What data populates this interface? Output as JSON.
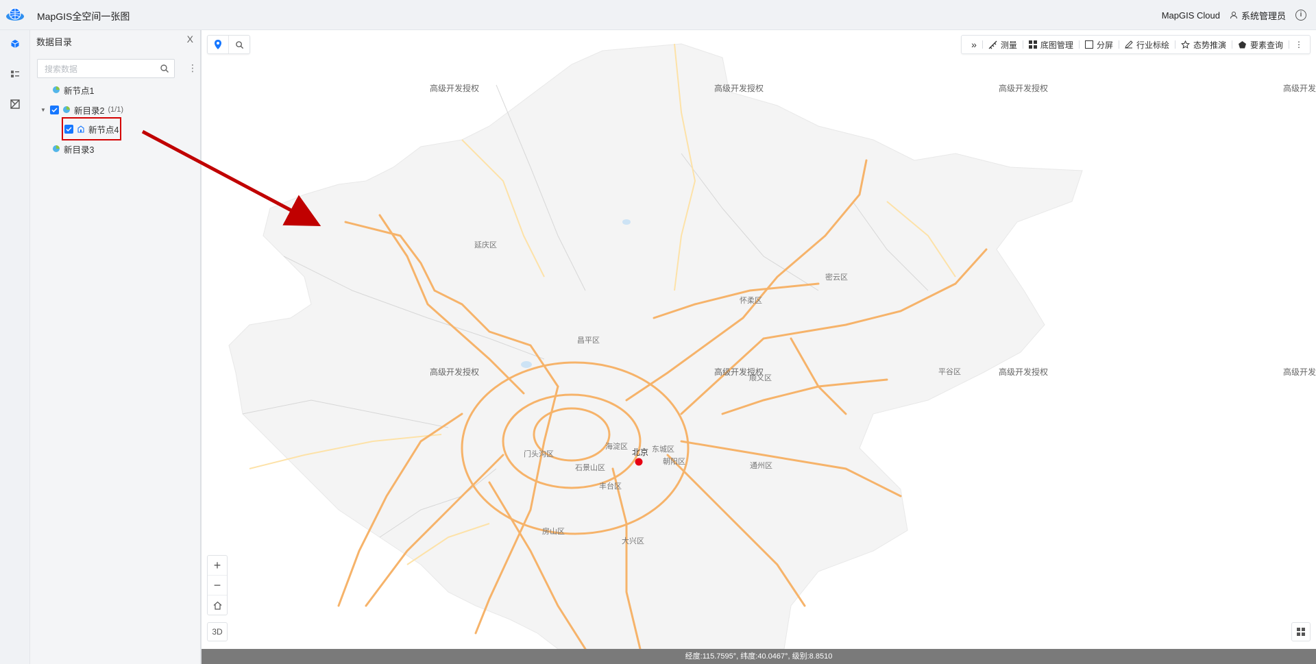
{
  "app": {
    "title": "MapGIS全空间一张图"
  },
  "header": {
    "cloud": "MapGIS Cloud",
    "user": "系统管理员",
    "info_glyph": "i"
  },
  "rail": {
    "items": [
      "cube-icon",
      "layer-list-icon",
      "analysis-icon"
    ]
  },
  "panel": {
    "title": "数据目录",
    "close": "X",
    "search_placeholder": "搜索数据",
    "more_glyph": "⋮",
    "tree": [
      {
        "label": "新节点1",
        "checked": null
      },
      {
        "label": "新目录2",
        "count": "(1/1)",
        "checked": true,
        "expanded": true
      },
      {
        "label": "新节点4",
        "checked": true,
        "highlighted": true
      },
      {
        "label": "新目录3",
        "checked": null
      }
    ]
  },
  "toolbar": {
    "collapse_glyph": "»",
    "items": [
      "测量",
      "底图管理",
      "分屏",
      "行业标绘",
      "态势推演",
      "要素查询"
    ],
    "more_glyph": "⋮"
  },
  "map": {
    "watermark": "高级开发授权",
    "capital": "北京",
    "districts": [
      "延庆区",
      "怀柔区",
      "密云区",
      "昌平区",
      "顺义区",
      "平谷区",
      "门头沟区",
      "海淀区",
      "东城区",
      "朝阳区",
      "石景山区",
      "丰台区",
      "通州区",
      "房山区",
      "大兴区"
    ],
    "road_color": "#f6b36a",
    "region_color": "#f4f4f4",
    "marker_color": "#e60012"
  },
  "controls": {
    "zoom_in": "+",
    "zoom_out": "−",
    "mode_3d": "3D"
  },
  "status": {
    "text": "经度:115.7595°, 纬度:40.0467°, 级别:8.8510"
  },
  "annotation": {
    "arrow_color": "#c00000",
    "box_color": "#d40000"
  }
}
